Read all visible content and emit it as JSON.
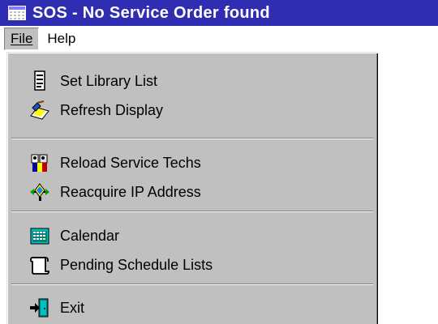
{
  "window": {
    "title": "SOS - No Service Order found",
    "title_bar_color": "#2f2eb3",
    "icon": "app-window-icon"
  },
  "menubar": {
    "items": [
      {
        "label": "File",
        "accelerator": "F",
        "active": true
      },
      {
        "label": "Help",
        "accelerator": "H",
        "active": false
      }
    ]
  },
  "file_menu": {
    "items": [
      {
        "label": "Set Library List",
        "icon": "library-list-icon"
      },
      {
        "label": "Refresh Display",
        "icon": "refresh-display-icon"
      },
      {
        "label": "Reload Service Techs",
        "icon": "service-techs-icon"
      },
      {
        "label": "Reacquire IP Address",
        "icon": "ip-address-icon"
      },
      {
        "label": "Calendar",
        "icon": "calendar-icon"
      },
      {
        "label": "Pending Schedule Lists",
        "icon": "schedule-list-icon"
      },
      {
        "label": "Exit",
        "icon": "exit-icon"
      }
    ],
    "background_color": "#c0c0c0"
  }
}
